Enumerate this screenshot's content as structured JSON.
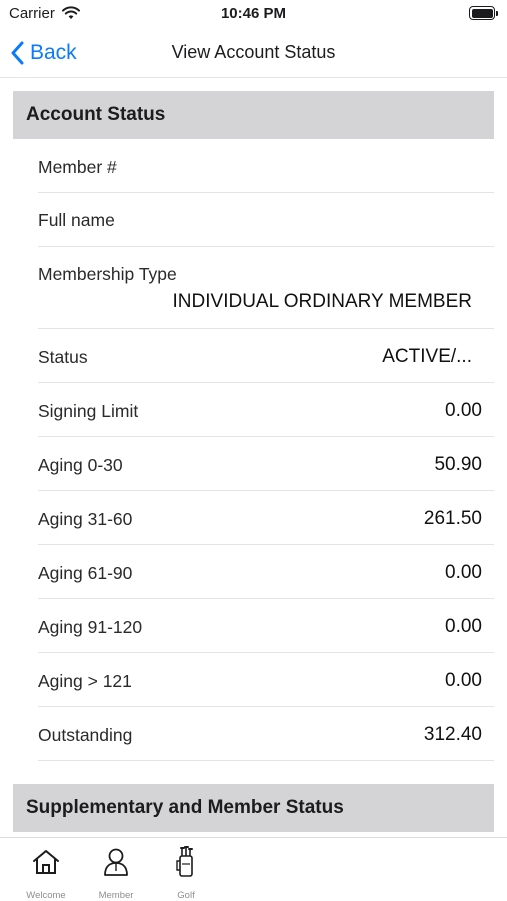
{
  "status_bar": {
    "carrier": "Carrier",
    "time": "10:46 PM"
  },
  "nav": {
    "back_label": "Back",
    "title": "View Account Status"
  },
  "account_section": {
    "title": "Account Status"
  },
  "rows": [
    {
      "label": "Member #",
      "value": ""
    },
    {
      "label": "Full name",
      "value": ""
    },
    {
      "label": "Membership Type",
      "value": "INDIVIDUAL ORDINARY MEMBER"
    },
    {
      "label": "Status",
      "value": "ACTIVE/..."
    },
    {
      "label": "Signing Limit",
      "value": "0.00"
    },
    {
      "label": "Aging 0-30",
      "value": "50.90"
    },
    {
      "label": "Aging 31-60",
      "value": "261.50"
    },
    {
      "label": "Aging 61-90",
      "value": "0.00"
    },
    {
      "label": "Aging 91-120",
      "value": "0.00"
    },
    {
      "label": "Aging > 121",
      "value": "0.00"
    },
    {
      "label": "Outstanding",
      "value": "312.40"
    }
  ],
  "supplementary_section": {
    "title": "Supplementary and Member Status"
  },
  "tabs": [
    {
      "label": "Welcome",
      "icon": "home-icon"
    },
    {
      "label": "Member",
      "icon": "member-icon"
    },
    {
      "label": "Golf",
      "icon": "golf-bag-icon"
    }
  ],
  "colors": {
    "accent": "#0a7aff",
    "section_header": "#d4d4d6"
  }
}
